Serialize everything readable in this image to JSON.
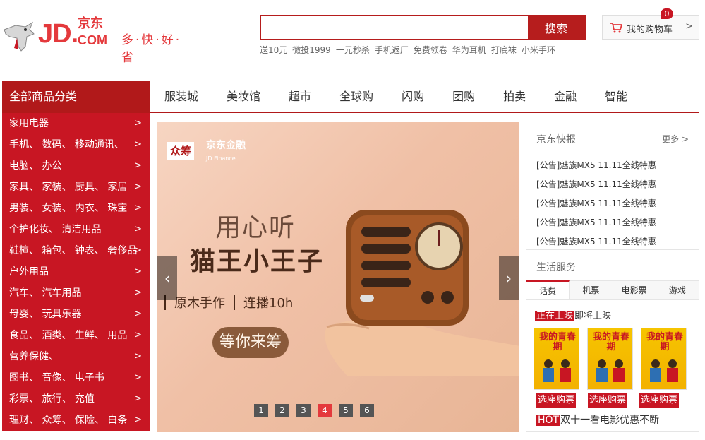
{
  "header": {
    "logo_cn": "京东",
    "logo_jd": "JD.",
    "logo_com": "COM",
    "slogan": "多·快·好·省",
    "search": {
      "value": "",
      "button_label": "搜索"
    },
    "hotwords": [
      "送10元",
      "微投1999",
      "一元秒杀",
      "手机返厂",
      "免费领卷",
      "华为耳机",
      "打底袜",
      "小米手环"
    ],
    "cart": {
      "label": "我的购物车",
      "count": "0",
      "arrow": ">"
    }
  },
  "navbar": {
    "all_category": "全部商品分类",
    "items": [
      "服装城",
      "美妆馆",
      "超市",
      "全球购",
      "闪购",
      "团购",
      "拍卖",
      "金融",
      "智能"
    ]
  },
  "categories": [
    "家用电器",
    "手机、 数码、 移动通讯、",
    "电脑、 办公",
    "家具、 家装、 厨具、 家居",
    "男装、 女装、 内衣、 珠宝",
    "个护化妆、 清洁用品",
    "鞋楦、 箱包、 钟表、 奢侈品",
    "户外用品",
    "汽车、 汽车用品",
    "母婴、 玩具乐器",
    "食品、 酒类、 生鲜、 用品",
    "营养保健、",
    "图书、 音像、 电子书",
    "彩票、 旅行、 充值",
    "理财、 众筹、 保险、 白条"
  ],
  "category_arrow": ">",
  "banner": {
    "badge": "众筹",
    "partner": "京东金融",
    "partner_sub": "JD Finance",
    "line1": "用心听",
    "line2": "猫王小王子",
    "feature1": "原木手作",
    "feature2": "连播10h",
    "cta": "等你来筹",
    "prev": "‹",
    "next": "›",
    "pages": [
      "1",
      "2",
      "3",
      "4",
      "5",
      "6"
    ],
    "active_page": 4
  },
  "news": {
    "title": "京东快报",
    "more": "更多 >",
    "items": [
      "[公告]魅族MX5 11.11全线特惠",
      "[公告]魅族MX5 11.11全线特惠",
      "[公告]魅族MX5 11.11全线特惠",
      "[公告]魅族MX5 11.11全线特惠",
      "[公告]魅族MX5 11.11全线特惠"
    ]
  },
  "life": {
    "title": "生活服务",
    "tabs": [
      "话费",
      "机票",
      "电影票",
      "游戏"
    ],
    "active_tab": 0,
    "subtab_active": "正在上映",
    "subtab_other": "即将上映",
    "movie_title": "我的青春期",
    "buy_label": "选座购票",
    "hot_badge": "HOT",
    "hot_text": "双十一看电影优惠不断"
  },
  "colors": {
    "brand_red": "#c81623",
    "nav_red": "#b1191a",
    "search_red": "#b61d1d"
  }
}
